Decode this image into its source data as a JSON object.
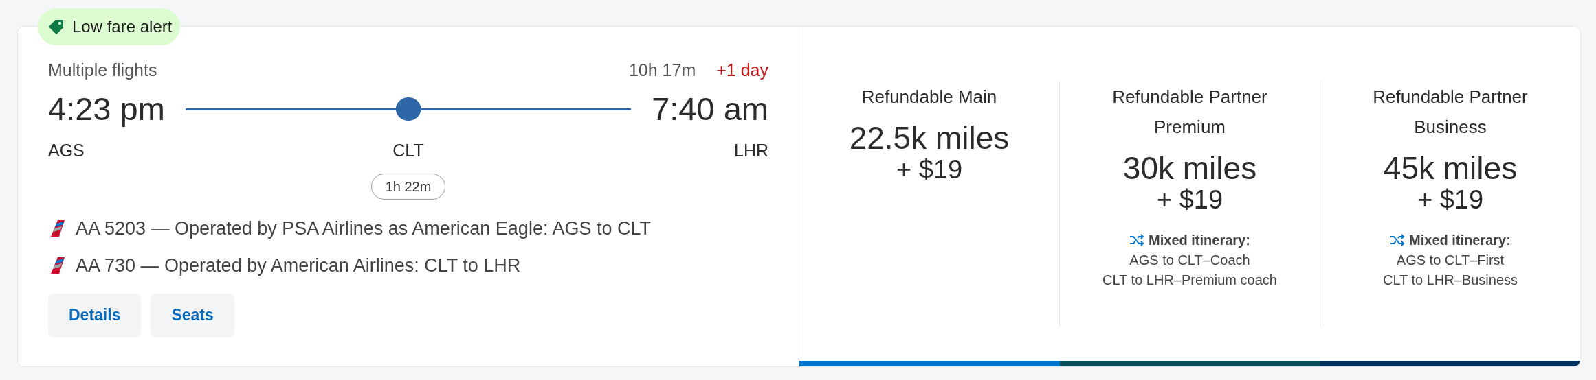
{
  "badge": {
    "label": "Low fare alert"
  },
  "trip": {
    "summary": "Multiple flights",
    "duration": "10h 17m",
    "day_offset": "+1 day",
    "depart": {
      "time": "4:23 pm",
      "airport": "AGS"
    },
    "stop": {
      "airport": "CLT",
      "layover": "1h 22m"
    },
    "arrive": {
      "time": "7:40 am",
      "airport": "LHR"
    }
  },
  "segments": [
    "AA 5203 — Operated by PSA Airlines as American Eagle: AGS to CLT",
    "AA 730 — Operated by American Airlines: CLT to LHR"
  ],
  "buttons": [
    "Details",
    "Seats"
  ],
  "fares": [
    {
      "name": "Refundable Main",
      "miles": "22.5k miles",
      "fee": "+ $19",
      "color": "#0074c8"
    },
    {
      "name": "Refundable Partner Premium",
      "miles": "30k miles",
      "fee": "+ $19",
      "color": "#0b4f5c",
      "note": {
        "title": "Mixed itinerary:",
        "lines": [
          "AGS to CLT–Coach",
          "CLT to LHR–Premium coach"
        ]
      }
    },
    {
      "name": "Refundable Partner Business",
      "miles": "45k miles",
      "fee": "+ $19",
      "color": "#01325f",
      "note": {
        "title": "Mixed itinerary:",
        "lines": [
          "AGS to CLT–First",
          "CLT to LHR–Business"
        ]
      }
    }
  ]
}
